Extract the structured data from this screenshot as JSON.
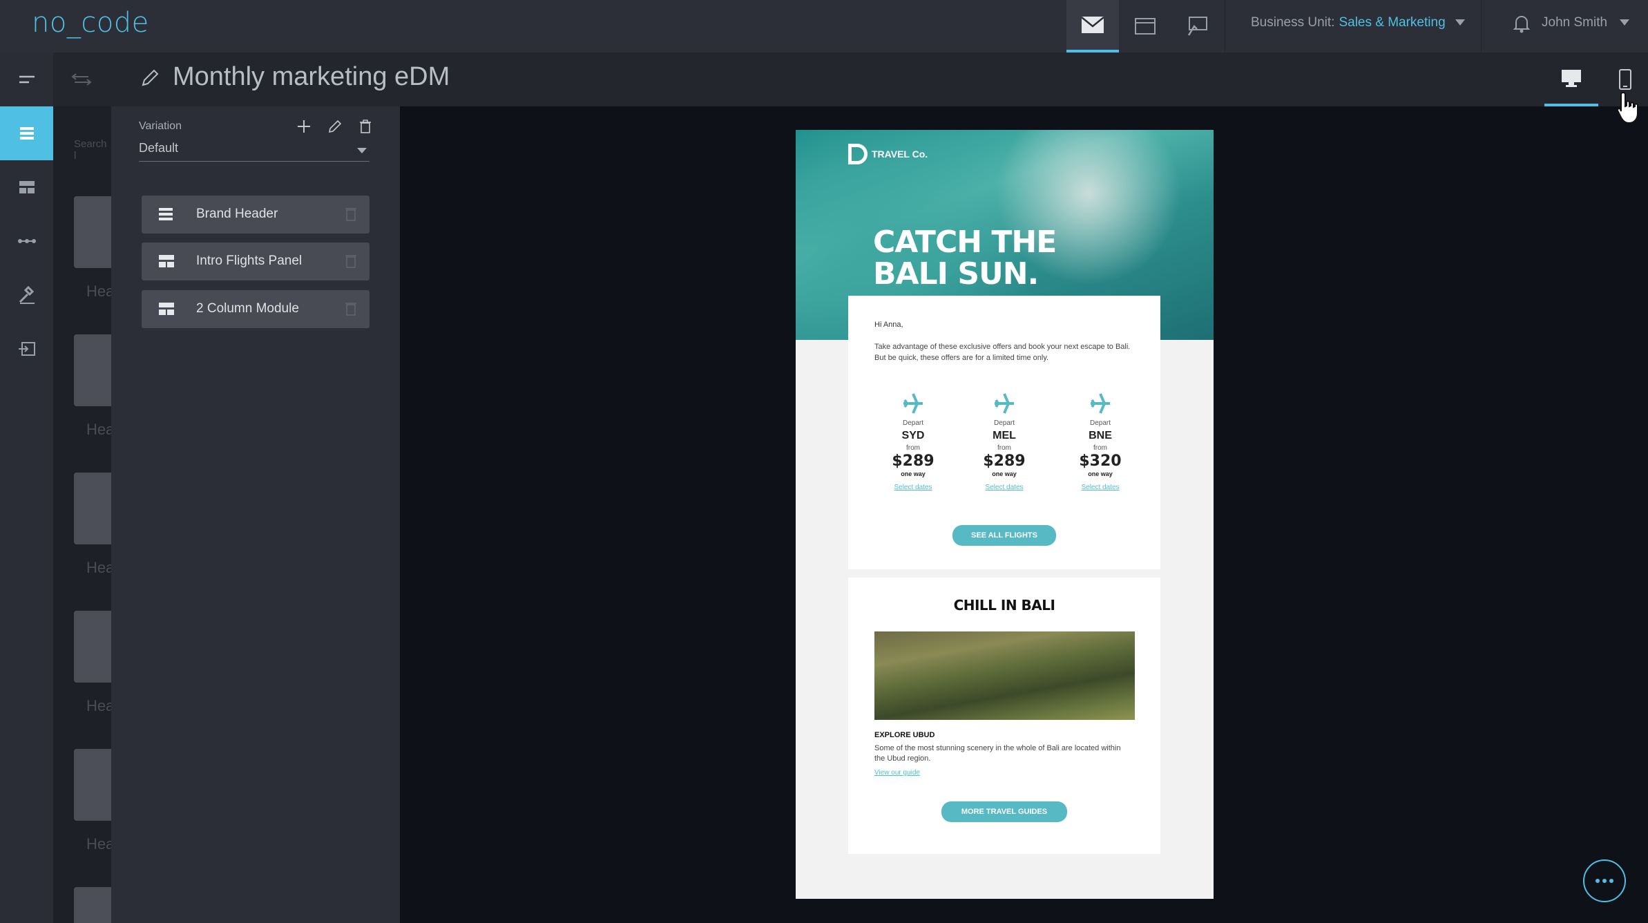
{
  "app": {
    "logo": "no_code"
  },
  "topbar": {
    "business_unit_label": "Business Unit:",
    "business_unit_value": "Sales & Marketing",
    "user_name": "John Smith"
  },
  "document": {
    "title": "Monthly marketing eDM"
  },
  "block_panel": {
    "search_placeholder": "Search l",
    "block_label": "Hea"
  },
  "variation": {
    "label": "Variation",
    "selected": "Default"
  },
  "modules": [
    {
      "label": "Brand Header"
    },
    {
      "label": "Intro Flights Panel"
    },
    {
      "label": "2 Column Module"
    }
  ],
  "email": {
    "brand": "TRAVEL Co.",
    "headline_line1": "CATCH THE",
    "headline_line2": "BALI SUN.",
    "greeting": "Hi Anna,",
    "intro": "Take advantage of these exclusive offers and book your next escape to Bali. But be quick, these offers are for a limited time only.",
    "flights": [
      {
        "depart": "Depart",
        "code": "SYD",
        "from": "from",
        "price": "$289",
        "oneway": "one way",
        "link": "Select dates"
      },
      {
        "depart": "Depart",
        "code": "MEL",
        "from": "from",
        "price": "$289",
        "oneway": "one way",
        "link": "Select dates"
      },
      {
        "depart": "Depart",
        "code": "BNE",
        "from": "from",
        "price": "$320",
        "oneway": "one way",
        "link": "Select dates"
      }
    ],
    "see_all_button": "SEE ALL FLIGHTS",
    "section_title": "CHILL IN BALI",
    "explore_title": "EXPLORE UBUD",
    "explore_desc": "Some of the most stunning scenery in the whole of Bali are located within the Ubud region.",
    "guide_link": "View our guide",
    "more_guides_button": "MORE TRAVEL GUIDES"
  },
  "colors": {
    "accent": "#4fc0e3",
    "button": "#56b9c3"
  }
}
